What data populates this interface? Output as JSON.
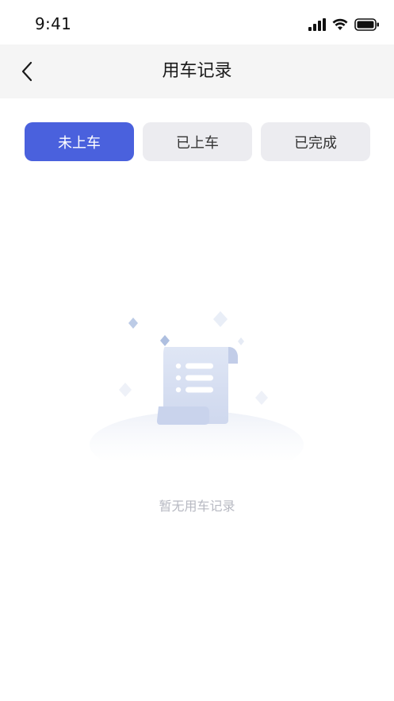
{
  "status_bar": {
    "time": "9:41"
  },
  "nav": {
    "title": "用车记录"
  },
  "tabs": [
    {
      "label": "未上车",
      "active": true
    },
    {
      "label": "已上车",
      "active": false
    },
    {
      "label": "已完成",
      "active": false
    }
  ],
  "empty_state": {
    "message": "暂无用车记录"
  },
  "colors": {
    "accent": "#4a61dd",
    "tab_inactive_bg": "#ececf0",
    "nav_bg": "#f5f5f5",
    "empty_text": "#b7b9c2"
  }
}
